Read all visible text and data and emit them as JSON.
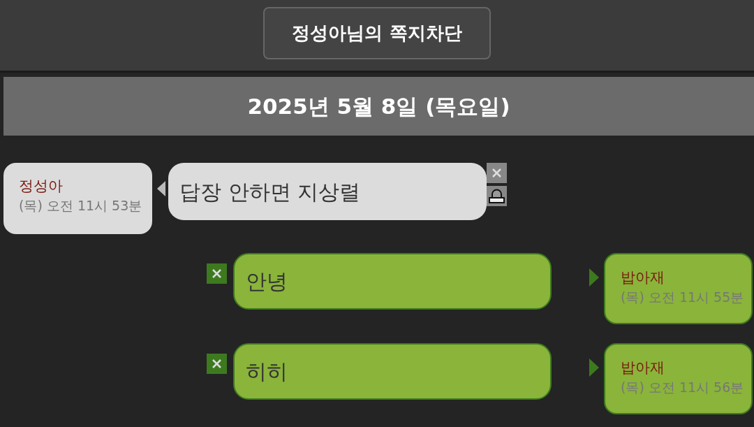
{
  "header": {
    "title": "정성아님의 쪽지차단"
  },
  "date": "2025년 5월 8일 (목요일)",
  "messages": [
    {
      "kind": "received",
      "sender": "정성아",
      "time": "(목) 오전 11시 53분",
      "text": "답장 안하면 지상렬"
    },
    {
      "kind": "sent",
      "sender": "밥아재",
      "time": "(목) 오전 11시 55분",
      "text": "안녕"
    },
    {
      "kind": "sent",
      "sender": "밥아재",
      "time": "(목) 오전 11시 56분",
      "text": "히히"
    }
  ]
}
